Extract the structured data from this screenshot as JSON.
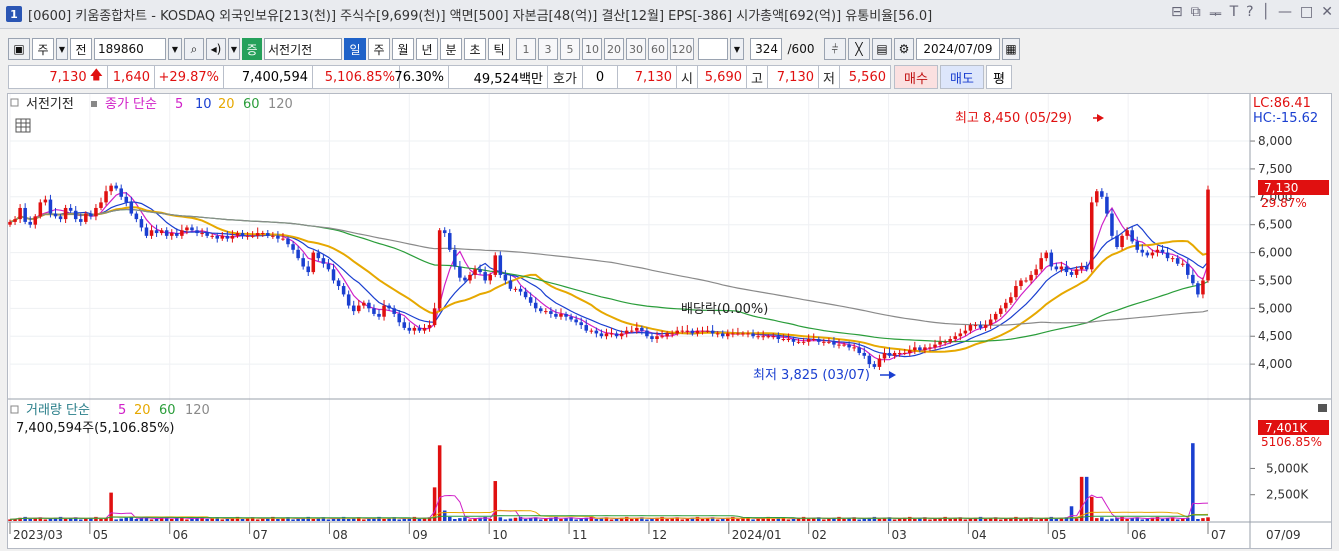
{
  "window": {
    "number": "1",
    "title": "[0600] 키움종합차트 - KOSDAQ 외국인보유[213(천)] 주식수[9,699(천)] 액면[500] 자본금[48(억)] 결산[12월] EPS[-386] 시가총액[692(억)] 유통비율[56.0]",
    "controls": [
      "⊟",
      "⧉",
      "ᆍ",
      "T",
      "?",
      "│",
      "—",
      "□",
      "✕"
    ]
  },
  "toolbar": {
    "type_label": "주",
    "prev_label": "전",
    "code": "189860",
    "stock_name": "서전기전",
    "badge": "증",
    "periods": [
      "일",
      "주",
      "월",
      "년",
      "분",
      "초",
      "틱"
    ],
    "active_period": "일",
    "intervals": [
      "1",
      "3",
      "5",
      "10",
      "20",
      "30",
      "60",
      "120"
    ],
    "count": "324",
    "max_count": "/600",
    "date": "2024/07/09"
  },
  "price": {
    "current": "7,130",
    "change": "1,640",
    "change_pct": "+29.87%",
    "volume": "7,400,594",
    "volume_ratio": "5,106.85%",
    "turnover": "76.30%",
    "amount": "49,524백만",
    "quote_label": "호가",
    "quote_value": "0",
    "quote_price": "7,130",
    "open_label": "시",
    "open": "5,690",
    "high_label": "고",
    "high": "7,130",
    "low_label": "저",
    "low": "5,560",
    "buy_label": "매수",
    "sell_label": "매도",
    "avg_label": "평"
  },
  "price_panel": {
    "legend_name": "서전기전",
    "legend_series": "종가 단순",
    "ma_labels": [
      "5",
      "10",
      "20",
      "60",
      "120"
    ],
    "lc": "LC:86.41",
    "hc": "HC:-15.62",
    "high_annotation": "최고 8,450 (05/29)",
    "low_annotation": "최저 3,825 (03/07)",
    "dividend_annotation": "배당락(0.00%)",
    "current_tag": "7,130",
    "current_pct": "29.87%"
  },
  "volume_panel": {
    "legend_series": "거래량 단순",
    "ma_labels": [
      "5",
      "20",
      "60",
      "120"
    ],
    "value_text": "7,400,594주(5,106.85%)",
    "current_tag": "7,401K",
    "current_pct": "5106.85%"
  },
  "colors": {
    "up": "#e01010",
    "down": "#1a3fd0",
    "ma5": "#d020c8",
    "ma10": "#1a3fd0",
    "ma20": "#e6a800",
    "ma60": "#2a9d3a",
    "ma120": "#8a8a8a"
  },
  "chart_data": {
    "type": "candlestick",
    "ylim": [
      3500,
      8700
    ],
    "y_ticks": [
      "8,000",
      "7,500",
      "7,000",
      "6,500",
      "6,000",
      "5,500",
      "5,000",
      "4,500",
      "4,000"
    ],
    "x_ticks": [
      "2023/03",
      "05",
      "06",
      "07",
      "08",
      "09",
      "10",
      "11",
      "12",
      "2024/01",
      "02",
      "03",
      "04",
      "05",
      "06",
      "07",
      "07/09"
    ],
    "close": [
      6550,
      6600,
      6800,
      6550,
      6500,
      6650,
      6900,
      6950,
      6700,
      6650,
      6600,
      6800,
      6750,
      6600,
      6550,
      6700,
      6650,
      6800,
      6900,
      7100,
      7200,
      7150,
      7000,
      6900,
      6700,
      6600,
      6450,
      6300,
      6400,
      6350,
      6400,
      6300,
      6350,
      6300,
      6400,
      6450,
      6400,
      6350,
      6350,
      6300,
      6300,
      6250,
      6300,
      6250,
      6300,
      6350,
      6300,
      6300,
      6300,
      6350,
      6350,
      6300,
      6300,
      6250,
      6250,
      6150,
      6050,
      5900,
      5750,
      5650,
      6000,
      5900,
      5800,
      5700,
      5500,
      5400,
      5250,
      5050,
      4950,
      5050,
      5100,
      5000,
      4900,
      4850,
      5050,
      5000,
      4900,
      4750,
      4650,
      4600,
      4650,
      4600,
      4650,
      4700,
      5000,
      6400,
      6350,
      6050,
      5750,
      5550,
      5500,
      5600,
      5700,
      5650,
      5500,
      5600,
      5950,
      5600,
      5500,
      5350,
      5350,
      5300,
      5200,
      5100,
      5000,
      4950,
      4950,
      4900,
      4850,
      4900,
      4850,
      4800,
      4750,
      4700,
      4600,
      4600,
      4550,
      4500,
      4550,
      4550,
      4500,
      4550,
      4600,
      4600,
      4650,
      4600,
      4500,
      4450,
      4500,
      4500,
      4550,
      4550,
      4600,
      4600,
      4600,
      4550,
      4600,
      4600,
      4600,
      4550,
      4550,
      4500,
      4550,
      4550,
      4550,
      4550,
      4550,
      4500,
      4500,
      4500,
      4500,
      4500,
      4450,
      4450,
      4450,
      4400,
      4400,
      4400,
      4450,
      4450,
      4400,
      4400,
      4400,
      4350,
      4350,
      4350,
      4300,
      4300,
      4200,
      4150,
      4000,
      3950,
      4100,
      4200,
      4150,
      4200,
      4200,
      4200,
      4250,
      4300,
      4250,
      4300,
      4300,
      4350,
      4400,
      4400,
      4450,
      4500,
      4550,
      4600,
      4700,
      4700,
      4650,
      4700,
      4800,
      4900,
      5000,
      5100,
      5200,
      5400,
      5500,
      5500,
      5600,
      5700,
      5900,
      6000,
      5750,
      5700,
      5750,
      5650,
      5600,
      5700,
      5750,
      5700,
      6900,
      7100,
      7000,
      6700,
      6300,
      6100,
      6300,
      6400,
      6200,
      6050,
      6000,
      5950,
      6000,
      6050,
      6000,
      5900,
      5900,
      5800,
      5800,
      5600,
      5450,
      5250,
      5500,
      7130
    ],
    "ma_series": [
      {
        "name": "5",
        "period": 5
      },
      {
        "name": "10",
        "period": 10
      },
      {
        "name": "20",
        "period": 20
      },
      {
        "name": "60",
        "period": 60
      },
      {
        "name": "120",
        "period": 120
      }
    ],
    "volume_ticks": [
      "5,000K",
      "2,500K"
    ],
    "volume_ylim": [
      0,
      7800
    ],
    "volume_spikes": [
      {
        "index": 20,
        "value": 2700
      },
      {
        "index": 84,
        "value": 3200
      },
      {
        "index": 85,
        "value": 7200
      },
      {
        "index": 86,
        "value": 1000
      },
      {
        "index": 96,
        "value": 3800
      },
      {
        "index": 210,
        "value": 1400
      },
      {
        "index": 212,
        "value": 4200
      },
      {
        "index": 213,
        "value": 4200
      },
      {
        "index": 214,
        "value": 2300
      },
      {
        "index": 234,
        "value": 7401
      }
    ]
  }
}
